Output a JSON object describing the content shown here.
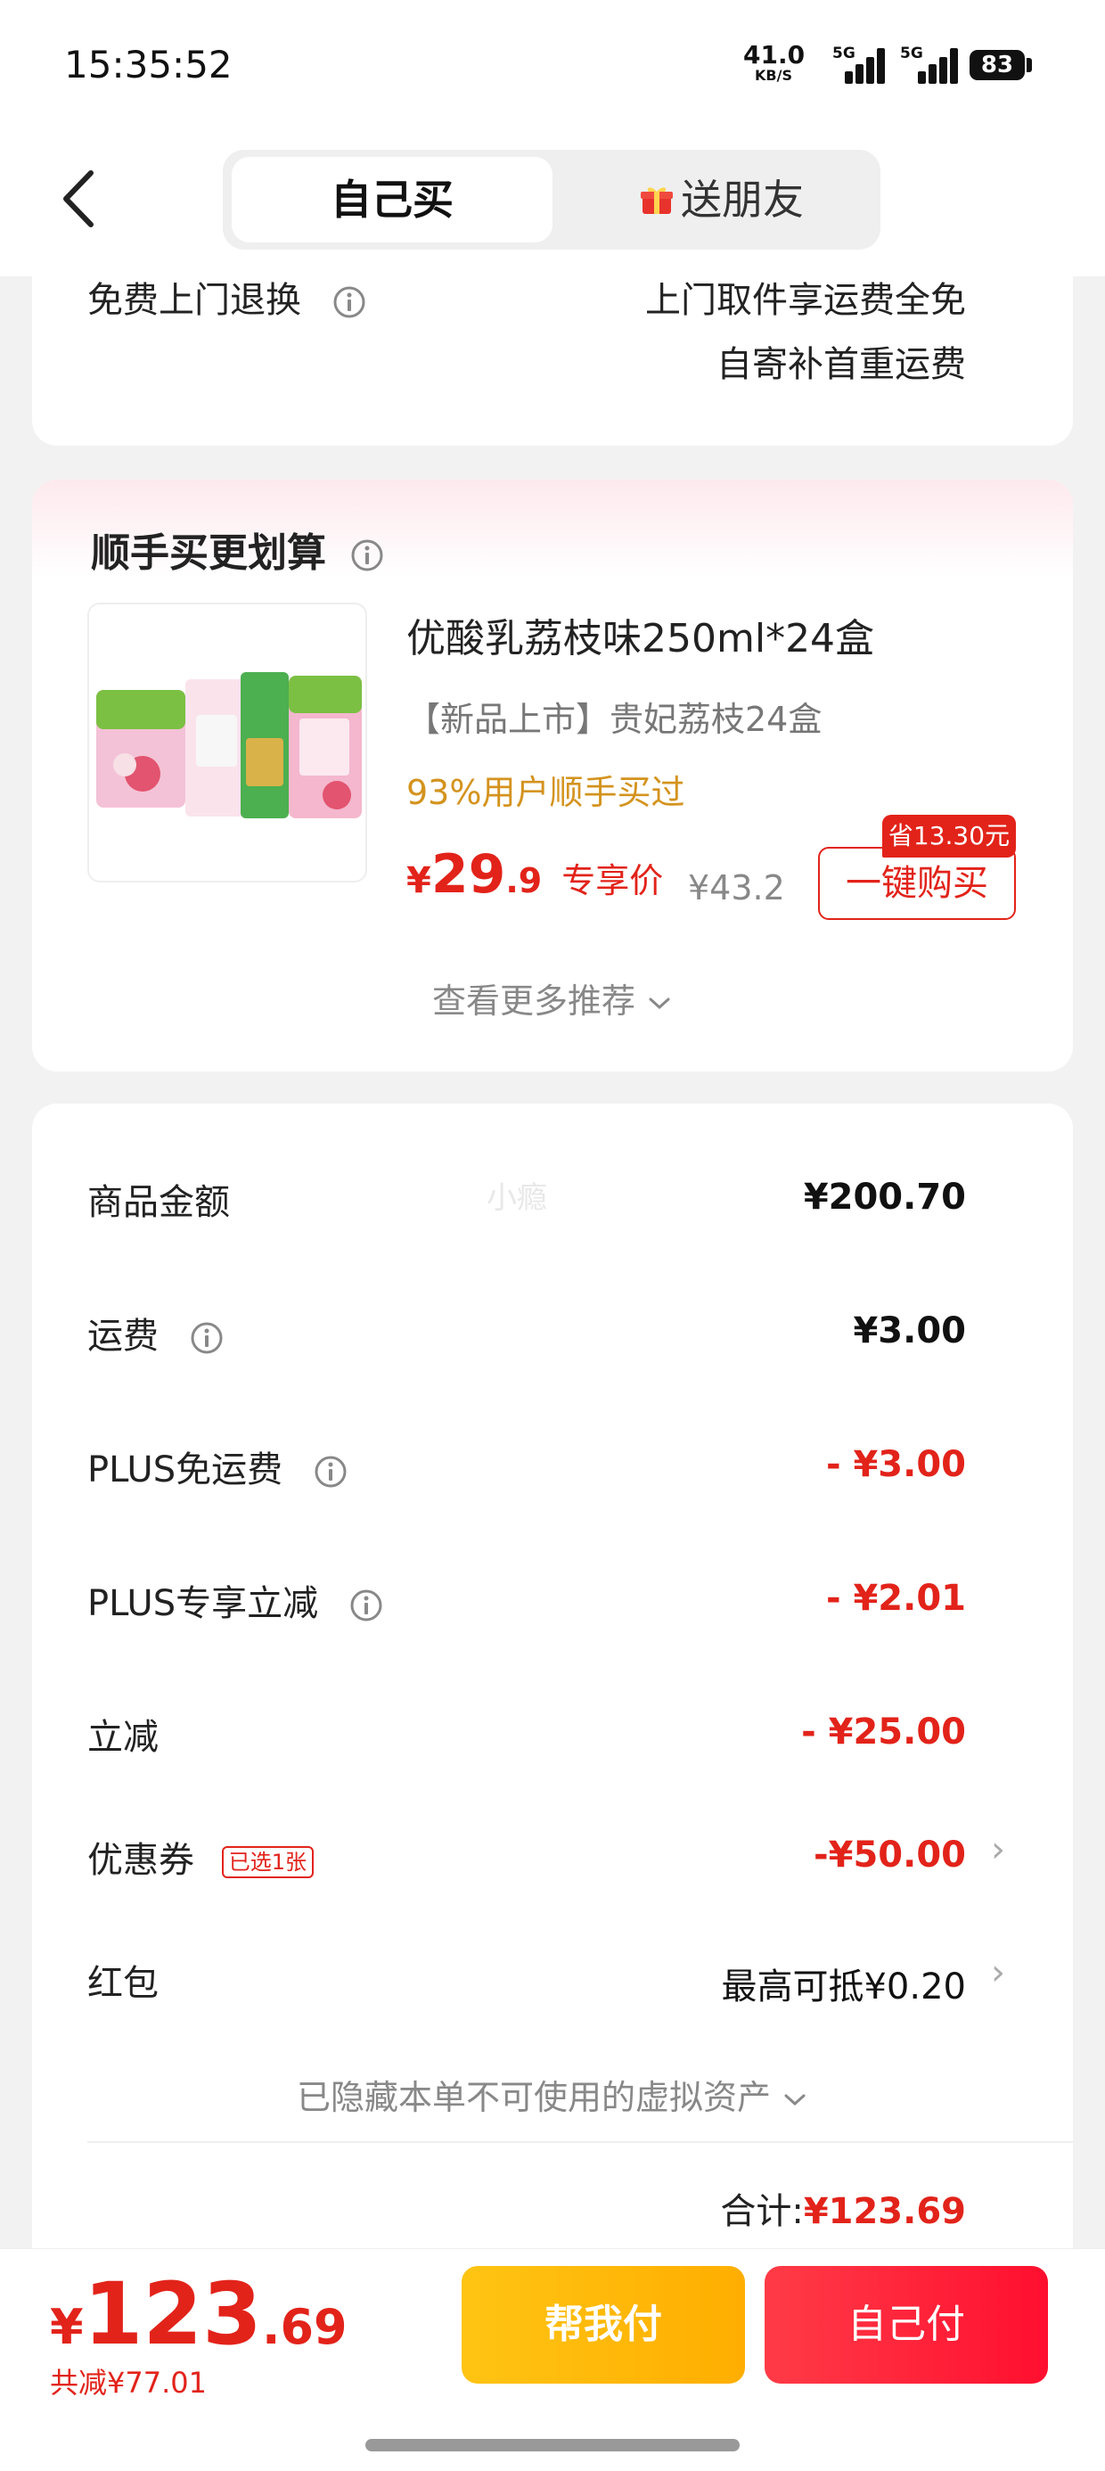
{
  "status_bar": {
    "time": "15:35:52",
    "net_speed": "41.0",
    "net_unit": "KB/S",
    "sim1": "5G",
    "sim2": "5G",
    "battery": "83"
  },
  "header": {
    "tab_self": "自己买",
    "tab_gift": "送朋友",
    "back_icon": "chevron-left-icon",
    "gift_icon": "gift-icon"
  },
  "return_service": {
    "label": "免费上门退换",
    "line1": "上门取件享运费全免",
    "line2": "自寄补首重运费"
  },
  "recommend": {
    "title": "顺手买更划算",
    "product_name": "优酸乳荔枝味250ml*24盒",
    "product_sub": "【新品上市】贵妃荔枝24盒",
    "rate": "93%用户顺手买过",
    "price_symbol": "¥",
    "price_int": "29",
    "price_dec": ".9",
    "price_label": "专享价",
    "orig_price": "¥43.2",
    "save_tag": "省13.30元",
    "buy_button": "一键购买",
    "more": "查看更多推荐"
  },
  "summary": {
    "watermark": "小瘾",
    "rows": [
      {
        "label": "商品金额",
        "value": "¥200.70"
      },
      {
        "label": "运费",
        "value": "¥3.00"
      },
      {
        "label": "PLUS免运费",
        "value": "- ¥3.00"
      },
      {
        "label": "PLUS专享立减",
        "value": "- ¥2.01"
      },
      {
        "label": "立减",
        "value": "- ¥25.00"
      },
      {
        "label": "优惠券",
        "tag": "已选1张",
        "value": "-¥50.00"
      },
      {
        "label": "红包",
        "value": "最高可抵¥0.20"
      }
    ],
    "hidden_assets": "已隐藏本单不可使用的虚拟资产",
    "total_label": "合计:",
    "total_value": "¥123.69"
  },
  "bottom": {
    "price_symbol": "¥",
    "price_int": "123",
    "price_dec": ".69",
    "saved": "共减¥77.01",
    "btn_help": "帮我付",
    "btn_self": "自己付"
  },
  "colors": {
    "accent_red": "#e2231a",
    "rate_orange": "#d4931e",
    "help_yellow": "#ffb800"
  }
}
